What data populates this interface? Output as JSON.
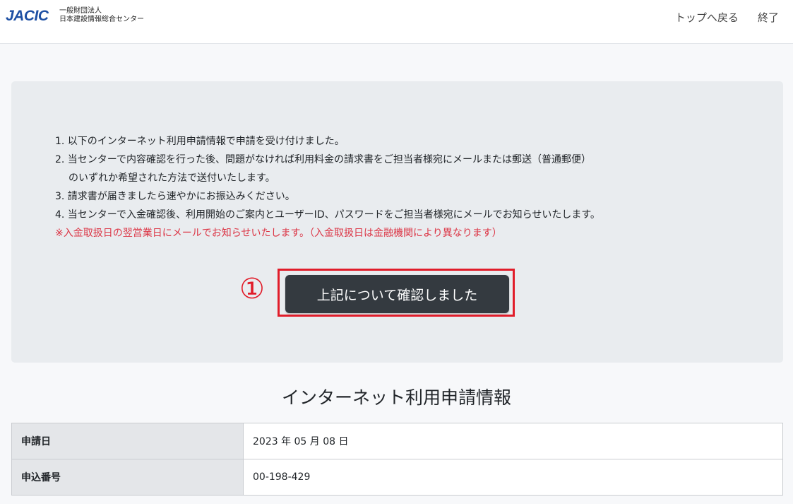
{
  "header": {
    "logo_mark": "JACIC",
    "logo_line1": "一般財団法人",
    "logo_line2": "日本建設情報総合センター",
    "nav": {
      "top_label": "トップへ戻る",
      "end_label": "終了"
    }
  },
  "notice": {
    "items": [
      "1. 以下のインターネット利用申請情報で申請を受け付けました。",
      "2. 当センターで内容確認を行った後、問題がなければ利用料金の請求書をご担当者様宛にメールまたは郵送（普通郵便）",
      "のいずれか希望された方法で送付いたします。",
      "3. 請求書が届きましたら速やかにお振込みください。",
      "4. 当センターで入金確認後、利用開始のご案内とユーザーID、パスワードをご担当者様宛にメールでお知らせいたします。"
    ],
    "warning": "※入金取扱日の翌営業日にメールでお知らせいたします。（入金取扱日は金融機関により異なります）",
    "step_marker": "①",
    "confirm_label": "上記について確認しました"
  },
  "info": {
    "title": "インターネット利用申請情報",
    "rows": [
      {
        "label": "申請日",
        "value": "2023 年 05 月 08 日"
      },
      {
        "label": "申込番号",
        "value": "00-198-429"
      }
    ]
  },
  "colors": {
    "brand": "#1d4fa3",
    "warning": "#dc3545",
    "highlight": "#e11d2a",
    "button": "#343a40"
  }
}
